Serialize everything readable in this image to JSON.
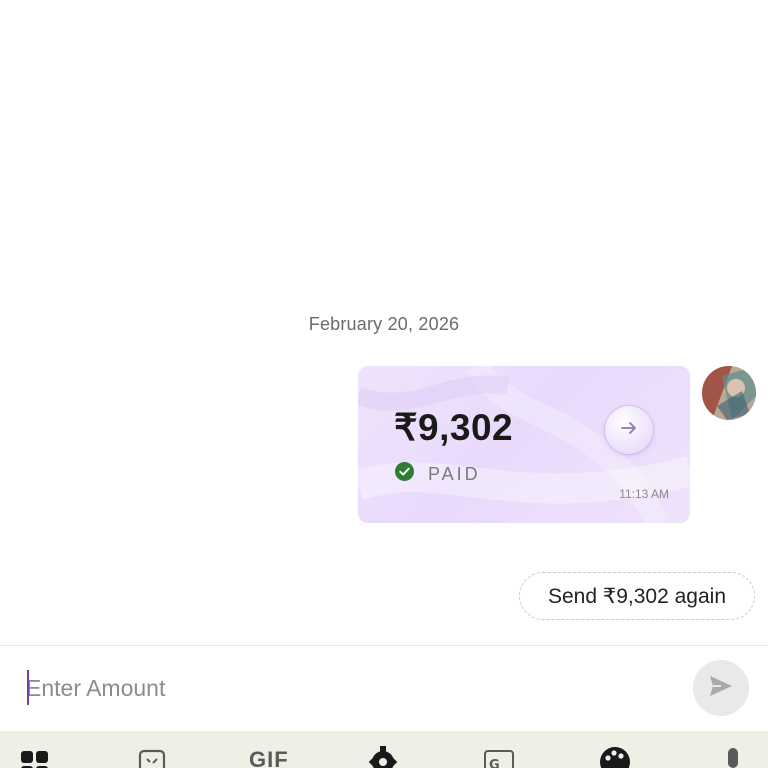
{
  "chat": {
    "date_separator": "February 20, 2026",
    "payment": {
      "amount": "₹9,302",
      "status": "PAID",
      "time": "11:13 AM"
    },
    "send_again_label": "Send ₹9,302 again"
  },
  "composer": {
    "placeholder": "Enter Amount",
    "value": ""
  },
  "keyboard_toolbar": {
    "items": [
      "apps-grid-icon",
      "sticker-icon",
      "GIF",
      "gear-icon",
      "translate-icon",
      "palette-icon",
      "microphone-icon"
    ]
  },
  "colors": {
    "card_background": "#eadcfb",
    "paid_check": "#2e7d32",
    "cursor": "#6a3fb0",
    "toolbar_background": "#eef0e6"
  }
}
